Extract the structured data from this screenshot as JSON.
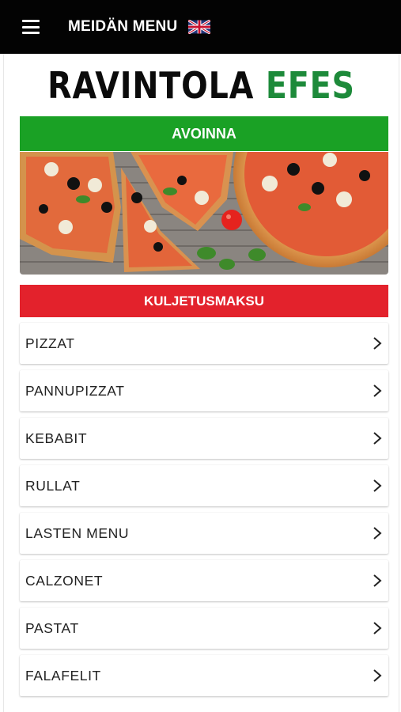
{
  "topbar": {
    "title": "MEIDÄN MENU",
    "menu_icon": "hamburger-icon",
    "language_icon": "uk-flag-icon"
  },
  "brand": {
    "name_part1": "RAVINTOLA",
    "name_part2": "EFES",
    "color_part1": "#0b0b0b",
    "color_part2": "#1d8a3a"
  },
  "status": {
    "open_label": "AVOINNA",
    "color": "#1aa125"
  },
  "hero": {
    "image": "pizza-photo"
  },
  "delivery": {
    "label": "KULJETUSMAKSU",
    "color": "#e3222c"
  },
  "menu": {
    "chevron_icon": "chevron-right-icon",
    "items": [
      {
        "label": "PIZZAT"
      },
      {
        "label": "PANNUPIZZAT"
      },
      {
        "label": "KEBABIT"
      },
      {
        "label": "RULLAT"
      },
      {
        "label": "LASTEN MENU"
      },
      {
        "label": "CALZONET"
      },
      {
        "label": "PASTAT"
      },
      {
        "label": "FALAFELIT"
      }
    ]
  }
}
